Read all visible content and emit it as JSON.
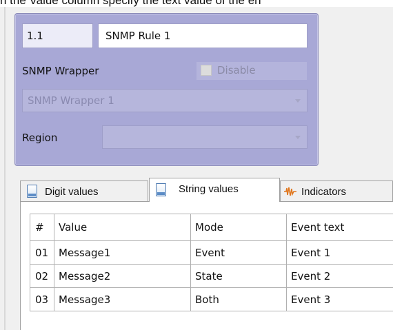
{
  "caption": "n the Value column specify the text value of the en",
  "rule": {
    "id": "1.1",
    "name": "SNMP Rule 1",
    "wrapper_label": "SNMP Wrapper",
    "disable_label": "Disable",
    "wrapper_value": "SNMP Wrapper 1",
    "region_label": "Region",
    "region_value": ""
  },
  "tabs": [
    {
      "label": "Digit values",
      "icon": "document-icon"
    },
    {
      "label": "String values",
      "icon": "document-icon",
      "active": true
    },
    {
      "label": "Indicators",
      "icon": "waveform-icon"
    }
  ],
  "table": {
    "columns": [
      "#",
      "Value",
      "Mode",
      "Event text"
    ],
    "rows": [
      [
        "01",
        "Message1",
        "Event",
        "Event 1"
      ],
      [
        "02",
        "Message2",
        "State",
        "Event 2"
      ],
      [
        "03",
        "Message3",
        "Both",
        "Event 3"
      ]
    ]
  },
  "colors": {
    "group_background": "#a8a8d6",
    "panel_background": "#f0f0f0",
    "icon_blue": "#4a78b0",
    "icon_orange": "#e07820"
  }
}
